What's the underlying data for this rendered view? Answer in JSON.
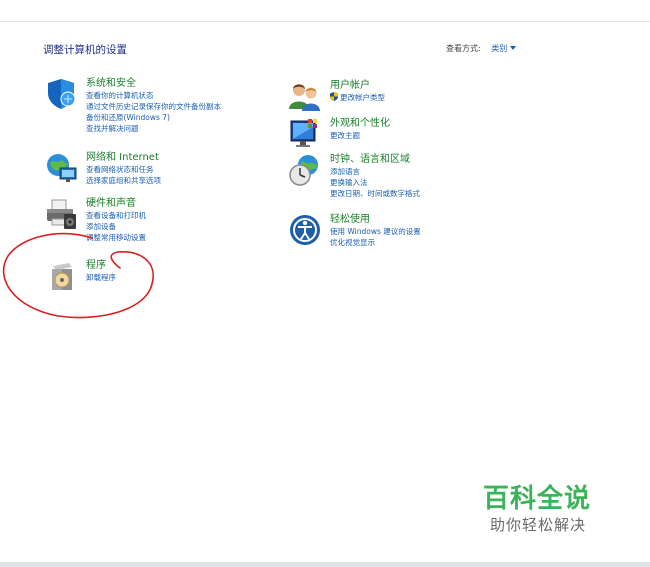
{
  "header": {
    "title": "调整计算机的设置",
    "view_by_label": "查看方式:",
    "view_by_value": "类别"
  },
  "categories": [
    {
      "title": "系统和安全",
      "icon": "system-security-shield-icon",
      "links": [
        "查看你的计算机状态",
        "通过文件历史记录保存你的文件备份副本",
        "备份和还原(Windows 7)",
        "查找并解决问题"
      ]
    },
    {
      "title": "网络和 Internet",
      "icon": "network-globe-icon",
      "links": [
        "查看网络状态和任务",
        "选择家庭组和共享选项"
      ]
    },
    {
      "title": "硬件和声音",
      "icon": "printer-hardware-icon",
      "links": [
        "查看设备和打印机",
        "添加设备",
        "调整常用移动设置"
      ]
    },
    {
      "title": "程序",
      "icon": "programs-disk-box-icon",
      "links": [
        "卸载程序"
      ]
    },
    {
      "title": "用户帐户",
      "icon": "user-accounts-icon",
      "links": [
        "更改帐户类型"
      ]
    },
    {
      "title": "外观和个性化",
      "icon": "appearance-monitor-icon",
      "links": [
        "更改主题"
      ]
    },
    {
      "title": "时钟、语言和区域",
      "icon": "clock-globe-icon",
      "links": [
        "添加语言",
        "更换输入法",
        "更改日期、时间或数字格式"
      ]
    },
    {
      "title": "轻松使用",
      "icon": "ease-of-access-icon",
      "links": [
        "使用 Windows 建议的设置",
        "优化视觉显示"
      ]
    }
  ],
  "watermark": {
    "main": "百科全说",
    "sub": "助你轻松解决"
  },
  "colors": {
    "title_blue": "#1e3287",
    "category_green": "#1a7f2a",
    "link_blue": "#1a5fb4",
    "annotation_red": "#d62020",
    "watermark_green": "#3cb35a"
  }
}
